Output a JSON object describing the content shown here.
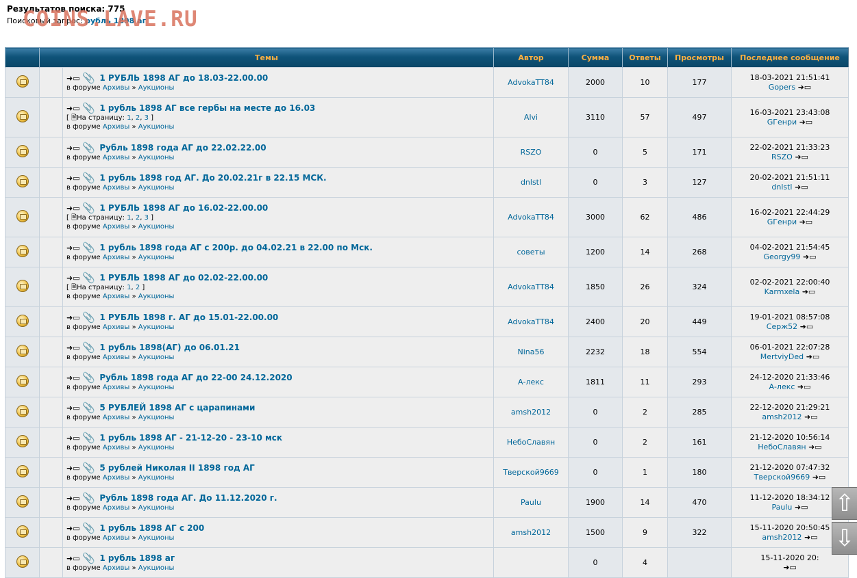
{
  "header": {
    "result_label": "Результатов поиска: 775",
    "query_label": "Поисковый запрос:",
    "query_value": "рубль 1898 аг"
  },
  "watermark": "COINS.LAVE.RU",
  "table": {
    "columns": [
      "Темы",
      "Автор",
      "Сумма",
      "Ответы",
      "Просмотры",
      "Последнее сообщение"
    ],
    "forum_prefix": "в форуме",
    "forum_name": "Архивы",
    "subforum_name": "Аукционы",
    "forum_sep": "»",
    "pages_label": "На страницу:",
    "rows": [
      {
        "title": "1 РУБЛЬ 1898 АГ до 18.03-22.00.00",
        "pages": [],
        "author": "AdvokaTT84",
        "sum": "2000",
        "replies": "10",
        "views": "177",
        "last_date": "18-03-2021 21:51:41",
        "last_user": "Gopers"
      },
      {
        "title": "1 рубль 1898 АГ все гербы на месте до 16.03",
        "pages": [
          "1",
          "2",
          "3"
        ],
        "author": "Alvi",
        "sum": "3110",
        "replies": "57",
        "views": "497",
        "last_date": "16-03-2021 23:43:08",
        "last_user": "GГенри"
      },
      {
        "title": "Рубль 1898 года АГ до 22.02.22.00",
        "pages": [],
        "author": "RSZO",
        "sum": "0",
        "replies": "5",
        "views": "171",
        "last_date": "22-02-2021 21:33:23",
        "last_user": "RSZO"
      },
      {
        "title": "1 рубль 1898 год АГ. До 20.02.21г в 22.15 МСК.",
        "pages": [],
        "author": "dnlstl",
        "sum": "0",
        "replies": "3",
        "views": "127",
        "last_date": "20-02-2021 21:51:11",
        "last_user": "dnlstl"
      },
      {
        "title": "1 РУБЛЬ 1898 АГ до 16.02-22.00.00",
        "pages": [
          "1",
          "2",
          "3"
        ],
        "author": "AdvokaTT84",
        "sum": "3000",
        "replies": "62",
        "views": "486",
        "last_date": "16-02-2021 22:44:29",
        "last_user": "GГенри"
      },
      {
        "title": "1 рубль 1898 года АГ с 200р. до 04.02.21 в 22.00 по Мск.",
        "pages": [],
        "author": "советы",
        "sum": "1200",
        "replies": "14",
        "views": "268",
        "last_date": "04-02-2021 21:54:45",
        "last_user": "Georgy99"
      },
      {
        "title": "1 РУБЛЬ 1898 АГ до 02.02-22.00.00",
        "pages": [
          "1",
          "2"
        ],
        "author": "AdvokaTT84",
        "sum": "1850",
        "replies": "26",
        "views": "324",
        "last_date": "02-02-2021 22:00:40",
        "last_user": "Karmxela"
      },
      {
        "title": "1 РУБЛЬ 1898 г. АГ до 15.01-22.00.00",
        "pages": [],
        "author": "AdvokaTT84",
        "sum": "2400",
        "replies": "20",
        "views": "449",
        "last_date": "19-01-2021 08:57:08",
        "last_user": "Серж52"
      },
      {
        "title": "1 рубль 1898(АГ) до 06.01.21",
        "pages": [],
        "author": "Nina56",
        "sum": "2232",
        "replies": "18",
        "views": "554",
        "last_date": "06-01-2021 22:07:28",
        "last_user": "MertviyDed"
      },
      {
        "title": "Рубль 1898 года АГ до 22-00 24.12.2020",
        "pages": [],
        "author": "А-лекс",
        "sum": "1811",
        "replies": "11",
        "views": "293",
        "last_date": "24-12-2020 21:33:46",
        "last_user": "А-лекс"
      },
      {
        "title": "5 РУБЛЕЙ 1898 АГ с царапинами",
        "pages": [],
        "author": "amsh2012",
        "sum": "0",
        "replies": "2",
        "views": "285",
        "last_date": "22-12-2020 21:29:21",
        "last_user": "amsh2012"
      },
      {
        "title": "1 рубль 1898 АГ - 21-12-20 - 23-10 мск",
        "pages": [],
        "author": "НебоСлавян",
        "sum": "0",
        "replies": "2",
        "views": "161",
        "last_date": "21-12-2020 10:56:14",
        "last_user": "НебоСлавян"
      },
      {
        "title": "5 рублей Николая II 1898 год АГ",
        "pages": [],
        "author": "Тверской9669",
        "sum": "0",
        "replies": "1",
        "views": "180",
        "last_date": "21-12-2020 07:47:32",
        "last_user": "Тверской9669"
      },
      {
        "title": "Рубль 1898 года АГ. До 11.12.2020 г.",
        "pages": [],
        "author": "Paulu",
        "sum": "1900",
        "replies": "14",
        "views": "470",
        "last_date": "11-12-2020 18:34:12",
        "last_user": "Paulu"
      },
      {
        "title": "1 рубль 1898 АГ с 200",
        "pages": [],
        "author": "amsh2012",
        "sum": "1500",
        "replies": "9",
        "views": "322",
        "last_date": "15-11-2020 20:50:45",
        "last_user": "amsh2012"
      },
      {
        "title": "1 рубль 1898 аг",
        "pages": [],
        "author": "",
        "sum": "0",
        "replies": "4",
        "views": "",
        "last_date": "15-11-2020 20:",
        "last_user": ""
      }
    ]
  },
  "scroll": {
    "up_glyph": "⇧",
    "down_glyph": "⇩"
  }
}
